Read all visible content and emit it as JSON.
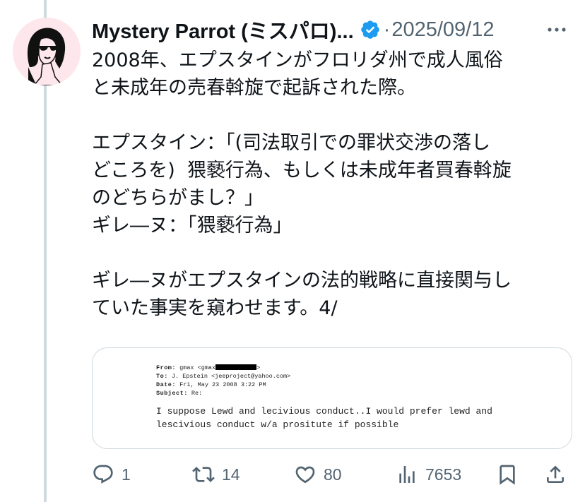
{
  "tweet": {
    "author": {
      "display_name": "Mystery Parrot (ミスパロ)...",
      "verified": true,
      "avatar_icon": "woman-with-sunglasses-avatar"
    },
    "separator": "·",
    "timestamp": "2025/09/12",
    "more_icon": "more-options-icon",
    "text": "2008年、エプスタインがフロリダ州で成人風俗\nと未成年の売春斡旋で起訴された際。\n\nエプスタイン：「(司法取引での罪状交渉の落し\nどころを)  猥褻行為、もしくは未成年者買春斡旋\nのどちらがまし？」\nギレ―ヌ：「猥褻行為」\n\nギレ―ヌがエプスタインの法的戦略に直接関与し\nていた事実を窺わせます。4/",
    "media": {
      "from_label": "From:",
      "from_value": "gmax <gmax",
      "from_suffix": ">",
      "to_label": "To:",
      "to_value": "J. Epstein <jeeproject@yahoo.com>",
      "date_label": "Date:",
      "date_value": "Fri, May 23 2008 3:22 PM",
      "subject_label": "Subject:",
      "subject_value": "Re:",
      "body_line_1": "I suppose Lewd and lecivious conduct..I would prefer lewd and",
      "body_line_2": "lescivious conduct w/a prositute if possible"
    },
    "actions": {
      "reply_count": "1",
      "retweet_count": "14",
      "like_count": "80",
      "views_count": "7653"
    }
  },
  "colors": {
    "text": "#0f1419",
    "secondary": "#536471",
    "verified_blue": "#1d9bf0",
    "thread_line": "#cfd9de"
  }
}
